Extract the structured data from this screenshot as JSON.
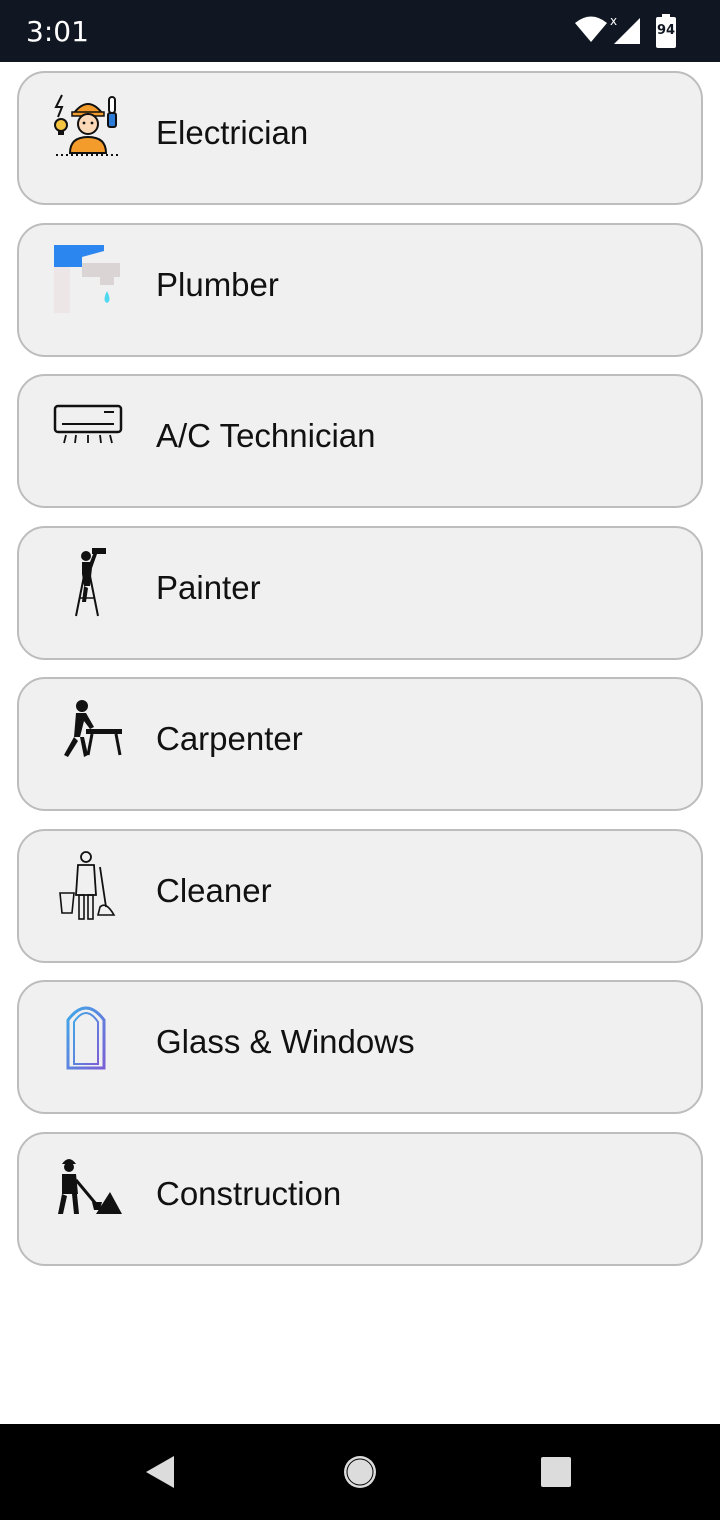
{
  "status_bar": {
    "time": "3:01",
    "battery_level": "94",
    "icons": [
      "wifi-icon",
      "signal-icon",
      "battery-icon"
    ]
  },
  "services": [
    {
      "label": "Electrician",
      "icon": "electrician-icon"
    },
    {
      "label": "Plumber",
      "icon": "faucet-icon"
    },
    {
      "label": "A/C Technician",
      "icon": "air-conditioner-icon"
    },
    {
      "label": "Painter",
      "icon": "painter-icon"
    },
    {
      "label": "Carpenter",
      "icon": "carpenter-icon"
    },
    {
      "label": "Cleaner",
      "icon": "cleaner-icon"
    },
    {
      "label": "Glass & Windows",
      "icon": "window-icon"
    },
    {
      "label": "Construction",
      "icon": "construction-worker-icon"
    }
  ],
  "nav_bar": {
    "icons": [
      "back-icon",
      "home-icon",
      "recents-icon"
    ]
  },
  "colors": {
    "status_bar_bg": "#111722",
    "card_bg": "#f0f0f0",
    "card_border": "#bdbdbd",
    "nav_bar_bg": "#000000"
  }
}
